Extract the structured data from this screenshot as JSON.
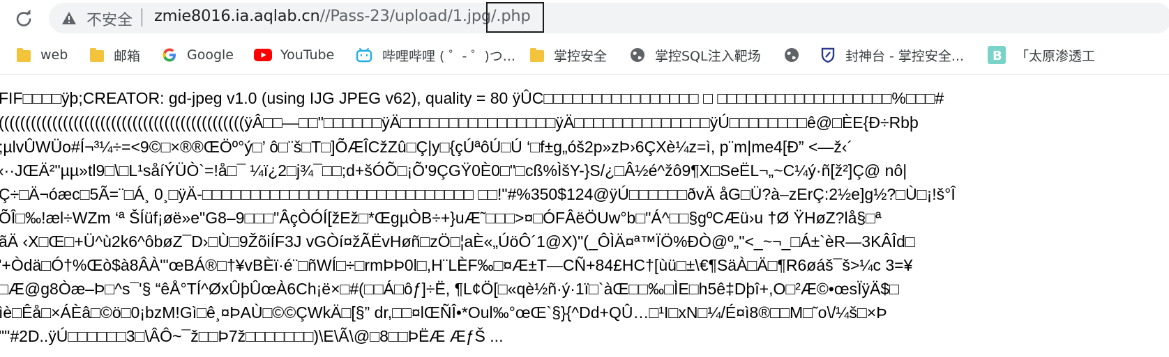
{
  "address_bar": {
    "security_label": "不安全",
    "url_host": "zmie8016.ia.aqlab.cn",
    "url_path": "//Pass-23/upload/1.jpg",
    "url_suffix": "/.php"
  },
  "bookmarks": [
    {
      "label": "web",
      "icon": "folder-icon"
    },
    {
      "label": "邮箱",
      "icon": "folder-icon"
    },
    {
      "label": "Google",
      "icon": "google-icon"
    },
    {
      "label": "YouTube",
      "icon": "youtube-icon"
    },
    {
      "label": "哔哩哔哩 ( ゜- ゜)つ...",
      "icon": "bilibili-icon"
    },
    {
      "label": "掌控安全",
      "icon": "folder-icon"
    },
    {
      "label": "掌控SQL注入靶场",
      "icon": "globe-icon"
    },
    {
      "label": "",
      "icon": "globe-icon"
    },
    {
      "label": "封神台 - 掌控安全...",
      "icon": "shield-icon"
    },
    {
      "label": "「太原渗透工",
      "icon": "b-icon"
    }
  ],
  "body_lines": [
    "FIF□□□□ÿþ;CREATOR: gd-jpeg v1.0 (using IJG JPEG v62), quality = 80 ÿÛC□□□□□□□□□□□□□□□□ □ □□□□□□□□□□□□□□□□□□%□□□#",
    "((((((((((((((((((((((((((((((((((((((((((((((ÿÂ□□—□□\"□□□□□□ÿÄ□□□□□□□□□□□□□□□□ÿÄ□□□□□□□□□□□□□□ÿÚ□□□□□□□□ê@□ÈE{Ð÷Rbþ",
    ";µlvÛWÜo#Í¬³¼÷=<9©□×®®ŒÖº°ý□’ ô□¨š□T□]ÕÆÎCžZû□Ç|y□{çÚªôÚ□Ú ‘□f±g„óš2p»zÞ›6ÇXè¼z=ì, p¨m|me4[Ð” <—ž‹´",
    "‹··JŒÄ²\"µµ»tl9□\\□L¹såíÝÜÒ`=!å□¯ ¼ï¿2□j¾¯□□;d+šÓÕ□¡Õ'9ÇGŸ0È0□\"□cß%ÌšY-}S/¿□Â½é^žô9¶X□SeËL¬„~C¼ý·ñ[ž²]Ç@ nô|",
    "Ç÷□Ä¬óæc□5Ã=¨□Á¸ 0¸□ÿÄ-□□□□□□□□□□□□□□□□□□□□□□□□□□□□ □□!\"#%350$124@ÿÚ□□□□□□ðvÄ åG□Ü?à–zErÇ:2½e]g½?□Ù□¡!š°Î",
    "ÕÎ□‰!æl÷WZm ‘ª ŠÍüf¡øë»e\"G8–9□□□\"ÂçÒÓÍ[žEž□*ŒgµÒB÷+}uÆ˜□□□>¤□ÓFÂëÖUw°b□\"Á^□□§gºCÆü›u †Ø ŸHøZ?lå§□ª",
    "ãÄ ‹X□Œ□+Ü^ù2k6^ôbøZ¯D›□Ù□9ŽõiÍF3J vGÒí¤žÃËvHøñ□zÖ□¦aÈ«„ÚöÔ´1@X)\"(_ÔÌÄ¤ª™ÏÖ%ÐÒ@º„\"<_~¬_□Á±`èR—3KÂÎd□",
    "'+Òdä□Ó†%Œò$à8ÂÀ'\"œBÁ®□†¥vBÈï·é¨□ñWÍ□÷□rmÞÞ0l□,H¨LÈF‰□¤Æ±T—CÑ+84£HC†[ùü□±\\€¶SäÀ□Ä□¶R6øáš¯š>¼c 3=¥",
    "□Æ@g8Òæ–Þ□^s¯'§ “êÅ°TÍ^ØxÛþÛœÀ6Ch¡ë×□#(□□Á□ôƒ]÷Ë, ¶L¢Ö[□«qè½ñ·ý·1ï□`àŒ□□‰□ÌE□h5ê‡Dþî+,O□²Æ©•œsÏÿÄ$□",
    "ìè□Êå□×ÁÈâ□©ö□0¡bzM!Gì□ê¸¤ÞAÙ□©©ÇWkÄ□[§” dr,□□¤lŒÑÎ•*Oul‰°œŒ`§}{^Dd+QÛ…□¹I□xN□¼/É¤ì8®□□M□˜o\\/¼š□×Þ",
    "\"\"#2D..ÿÚ□□□□□□3□\\ÂÔ~¯ž□□Þ7ž□□□□□□□)\\E\\Ã\\@□8□□ÞËÆ ÆƒŠ ..."
  ]
}
